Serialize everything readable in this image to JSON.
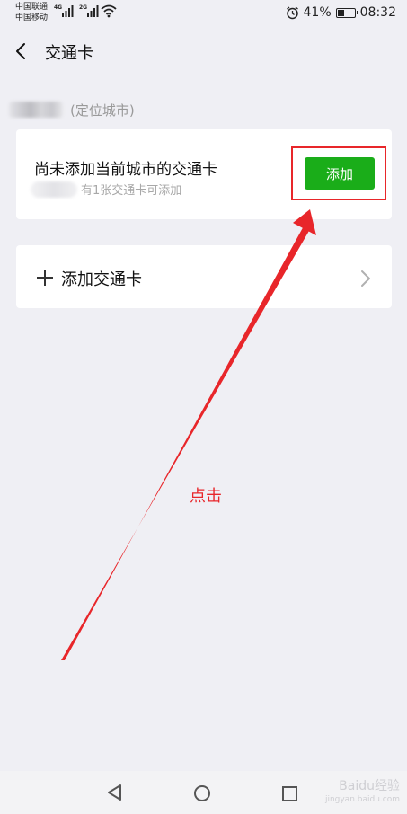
{
  "status_bar": {
    "carrier_1": "中国联通",
    "network_1": "4G",
    "network_2": "2G",
    "carrier_2": "中国移动",
    "battery_percent": "41%",
    "battery_level": 0.41,
    "time": "08:32"
  },
  "nav": {
    "title": "交通卡"
  },
  "city": {
    "label": "(定位城市)"
  },
  "current_city_card": {
    "title": "尚未添加当前城市的交通卡",
    "subtitle": "有1张交通卡可添加",
    "add_button_label": "添加"
  },
  "add_card_row": {
    "label": "添加交通卡"
  },
  "annotation": {
    "label": "点击",
    "color": "#e8262a"
  },
  "watermark": {
    "text": "Baidu经验",
    "sub": "jingyan.baidu.com"
  },
  "colors": {
    "background": "#efeff4",
    "button_green": "#1aad19",
    "highlight_red": "#e8262a"
  }
}
